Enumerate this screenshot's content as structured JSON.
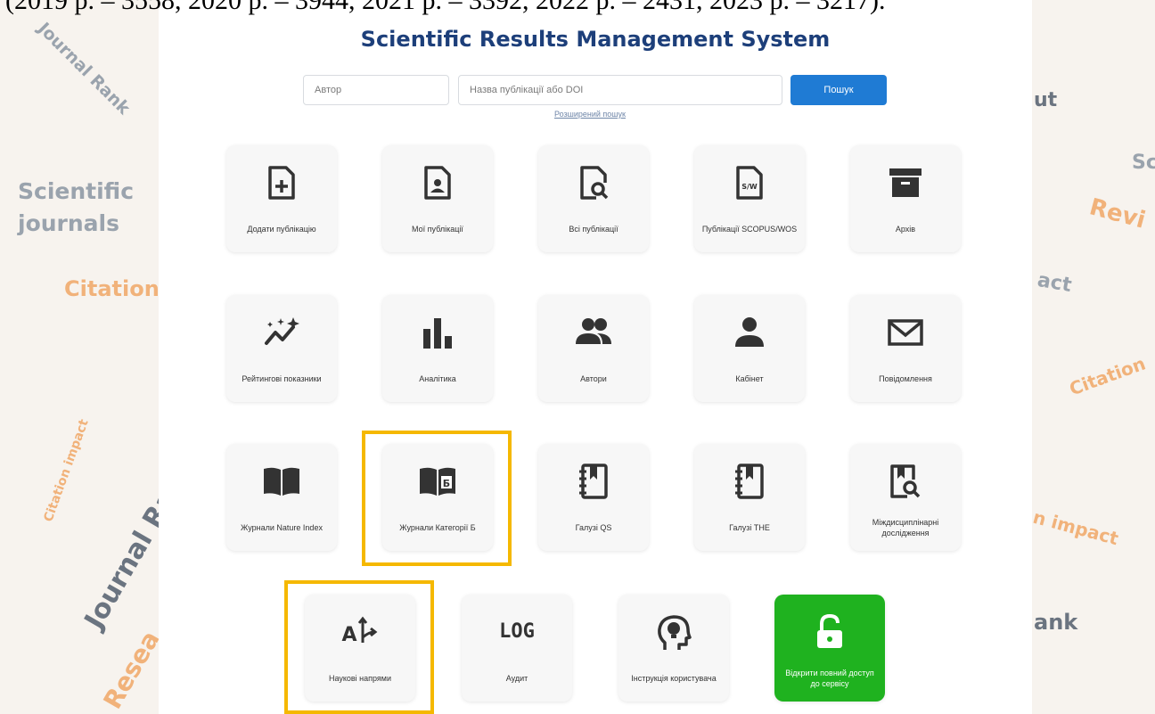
{
  "doc_top_text": "(2019 р. – 3558, 2020 р. – 3944, 2021 р. – 3392, 2022 р. – 2431, 2023 р. – 3217).",
  "background": {
    "left": [
      "Journal Rank",
      "Scientific",
      "journals",
      "Citation",
      "Citation impact",
      "Journal Ra",
      "Resea"
    ],
    "right": [
      "ut",
      "Sc",
      "Revi",
      "act",
      "Citation",
      "n impact",
      "ank"
    ]
  },
  "header": {
    "title": "Scientific Results Management System"
  },
  "search": {
    "author_placeholder": "Автор",
    "title_placeholder": "Назва публікації або DOI",
    "button_label": "Пошук",
    "advanced_link": "Розширений пошук"
  },
  "tiles": {
    "add_publication": "Додати публікацію",
    "my_publications": "Мої публікації",
    "all_publications": "Всі публікації",
    "scopus_wos": "Публікації SCOPUS/WOS",
    "archive": "Архів",
    "ratings": "Рейтингові показники",
    "analytics": "Аналітика",
    "authors": "Автори",
    "cabinet": "Кабінет",
    "messages": "Повідомлення",
    "nature_index": "Журнали Nature Index",
    "category_b": "Журнали Категорії Б",
    "qs_fields": "Галузі QS",
    "the_fields": "Галузі THE",
    "interdisciplinary": "Міждисциплінарні дослідження",
    "research_areas": "Наукові напрями",
    "audit": "Аудит",
    "instructions": "Інструкція користувача",
    "full_access": "Відкрити повний доступ до сервісу"
  },
  "icons": {
    "log_text": "LOG",
    "sw_text": "S/W",
    "b_letter": "Б",
    "az_text": "A"
  },
  "colors": {
    "title": "#1d3f7a",
    "search_button": "#1f7bd4",
    "highlight": "#f5b800",
    "green_tile": "#1fb21f",
    "icon": "#333333"
  }
}
